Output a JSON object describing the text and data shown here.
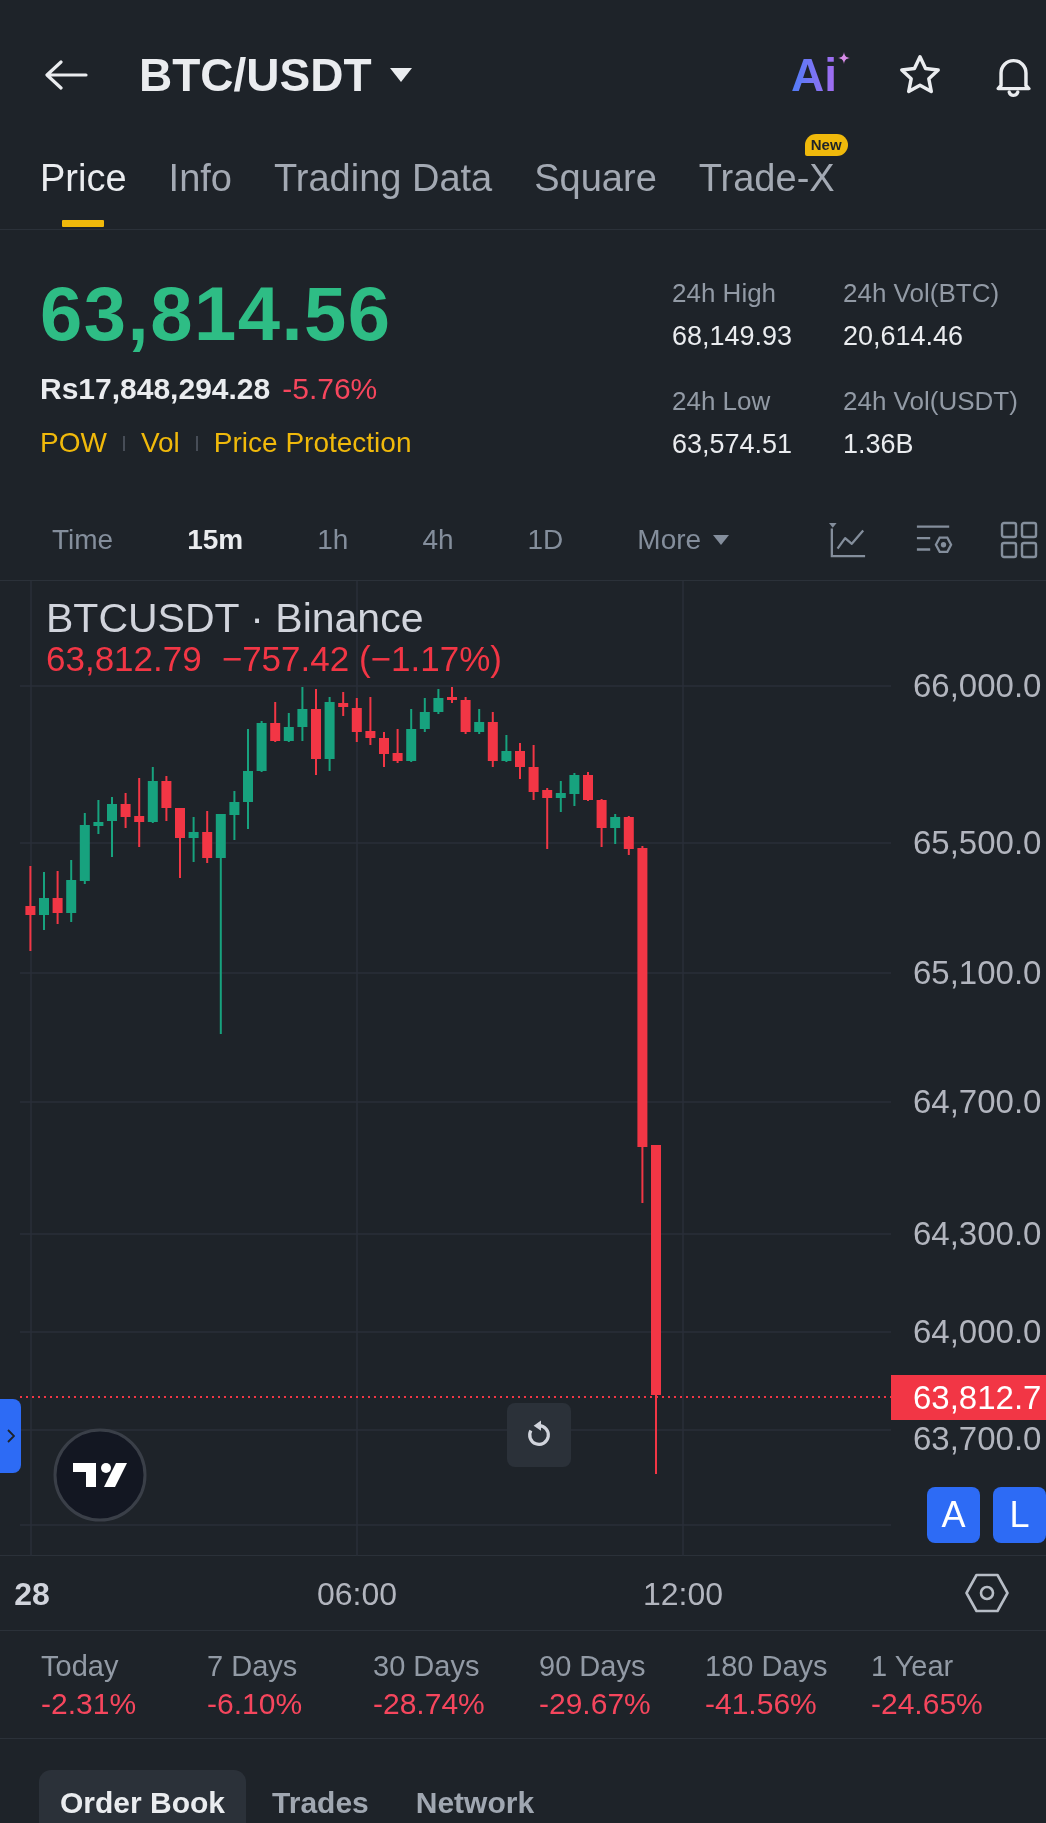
{
  "header": {
    "title": "BTC/USDT",
    "ai_label": "Ai"
  },
  "tabs": [
    {
      "label": "Price",
      "selected": true
    },
    {
      "label": "Info",
      "selected": false
    },
    {
      "label": "Trading Data",
      "selected": false
    },
    {
      "label": "Square",
      "selected": false
    },
    {
      "label": "Trade-X",
      "selected": false,
      "badge": "New"
    }
  ],
  "ticker": {
    "last_price": "63,814.56",
    "fiat_price": "Rs17,848,294.28",
    "change_percent": "-5.76%",
    "tags": [
      "POW",
      "Vol",
      "Price Protection"
    ],
    "stats": [
      {
        "label": "24h High",
        "value": "68,149.93"
      },
      {
        "label": "24h Vol(BTC)",
        "value": "20,614.46"
      },
      {
        "label": "24h Low",
        "value": "63,574.51"
      },
      {
        "label": "24h Vol(USDT)",
        "value": "1.36B"
      }
    ]
  },
  "intervals": [
    {
      "label": "Time",
      "kind": "period",
      "selected": false
    },
    {
      "label": "15m",
      "kind": "period",
      "selected": true
    },
    {
      "label": "1h",
      "kind": "period",
      "selected": false
    },
    {
      "label": "4h",
      "kind": "period",
      "selected": false
    },
    {
      "label": "1D",
      "kind": "period",
      "selected": false
    },
    {
      "label": "More",
      "kind": "menu",
      "selected": false
    }
  ],
  "chart": {
    "title": "BTCUSDT · Binance",
    "legend_price": "63,812.79",
    "legend_change": "−757.42 (−1.17%)",
    "price_axis": [
      "66,000.0",
      "65,500.0",
      "65,100.0",
      "64,700.0",
      "64,300.0",
      "64,000.0",
      "63,700.0"
    ],
    "last_price_tag": "63,812.7",
    "time_axis": [
      "28",
      "06:00",
      "12:00"
    ],
    "scale_buttons": [
      "A",
      "L"
    ]
  },
  "performance": [
    {
      "period": "Today",
      "change": "-2.31%"
    },
    {
      "period": "7 Days",
      "change": "-6.10%"
    },
    {
      "period": "30 Days",
      "change": "-28.74%"
    },
    {
      "period": "90 Days",
      "change": "-29.67%"
    },
    {
      "period": "180 Days",
      "change": "-41.56%"
    },
    {
      "period": "1 Year",
      "change": "-24.65%"
    }
  ],
  "bottom_tabs": [
    {
      "label": "Order Book",
      "selected": true
    },
    {
      "label": "Trades",
      "selected": false
    },
    {
      "label": "Network",
      "selected": false
    }
  ]
}
